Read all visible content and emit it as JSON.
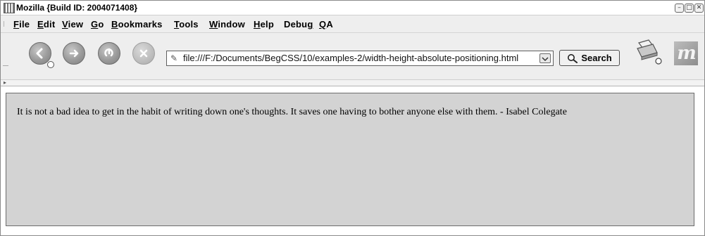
{
  "window": {
    "title": "Mozilla {Build ID: 2004071408}",
    "controls": {
      "minimize": "–",
      "maximize": "□",
      "close": "✕"
    }
  },
  "menu": {
    "items": [
      {
        "accel": "F",
        "rest": "ile"
      },
      {
        "accel": "E",
        "rest": "dit"
      },
      {
        "accel": "V",
        "rest": "iew"
      },
      {
        "accel": "G",
        "rest": "o"
      },
      {
        "accel": "B",
        "rest": "ookmarks"
      },
      {
        "accel": "T",
        "rest": "ools"
      },
      {
        "accel": "W",
        "rest": "indow"
      },
      {
        "accel": "H",
        "rest": "elp"
      },
      {
        "pre": "Debu",
        "accel": "g",
        "rest": ""
      },
      {
        "accel": "Q",
        "rest": "A"
      }
    ]
  },
  "toolbar": {
    "back_icon": "back-arrow-icon",
    "forward_icon": "forward-arrow-icon",
    "reload_icon": "reload-icon",
    "stop_icon": "stop-icon",
    "url": "file:///F:/Documents/BegCSS/10/examples-2/width-height-absolute-positioning.html",
    "search_label": "Search",
    "print_icon": "print-icon",
    "brand_letter": "m"
  },
  "content": {
    "quote": "It is not a bad idea to get in the habit of writing down one's thoughts. It saves one having to bother anyone else with them. - Isabel Colegate"
  },
  "colors": {
    "box_background": "#d3d3d3",
    "chrome_background": "#eeeeee"
  }
}
